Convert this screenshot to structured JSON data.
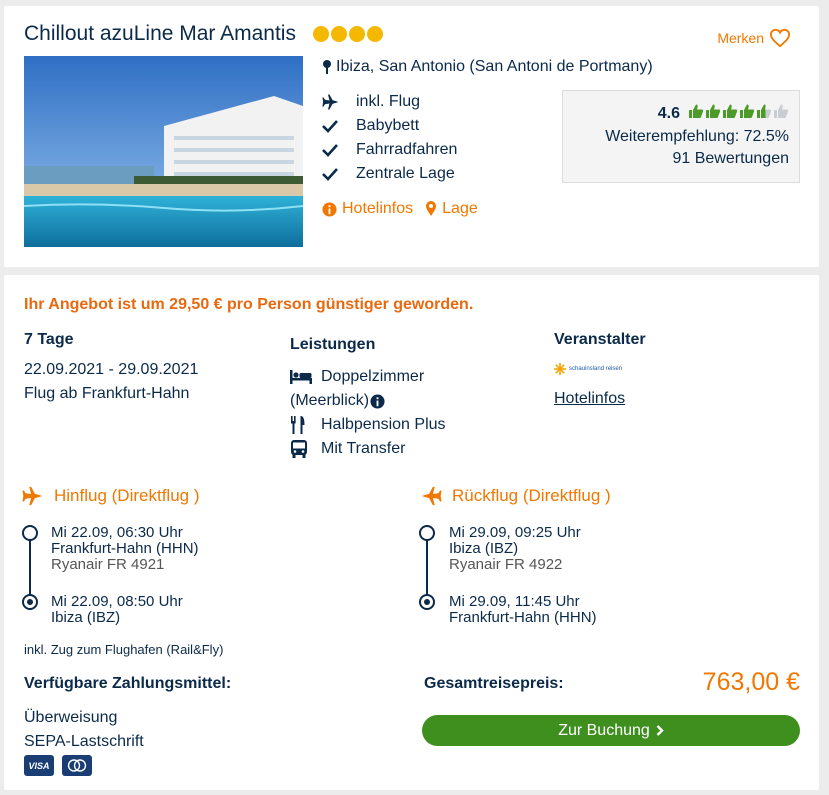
{
  "hotel": {
    "name": "Chillout azuLine Mar Amantis",
    "stars": 4,
    "merken_label": "Merken",
    "location": "Ibiza, San Antonio (San Antoni de Portmany)",
    "features": [
      "inkl. Flug",
      "Babybett",
      "Fahrradfahren",
      "Zentrale Lage"
    ],
    "links": {
      "hotelinfos": "Hotelinfos",
      "lage": "Lage"
    },
    "rating": {
      "score": "4.6",
      "thumbs_total": 6,
      "thumbs_value": 4.6,
      "recommendation": "Weiterempfehlung: 72.5%",
      "reviews": "91 Bewertungen"
    }
  },
  "offer": {
    "notice": "Ihr Angebot ist um 29,50 € pro Person günstiger geworden.",
    "duration": "7 Tage",
    "date_range": "22.09.2021 - 29.09.2021",
    "departure": "Flug ab Frankfurt-Hahn",
    "leistungen_heading": "Leistungen",
    "leistungen": {
      "room_line1": "Doppelzimmer",
      "room_line2": "(Meerblick)",
      "board": "Halbpension Plus",
      "transfer": "Mit Transfer"
    },
    "veranstalter_heading": "Veranstalter",
    "veranstalter_logo_text": "schauinsland reisen",
    "veranstalter_link": "Hotelinfos"
  },
  "flights": {
    "outbound": {
      "heading": "Hinflug (Direktflug )",
      "dep_time": "Mi 22.09, 06:30 Uhr",
      "dep_airport": "Frankfurt-Hahn (HHN)",
      "flight_no": "Ryanair FR 4921",
      "arr_time": "Mi 22.09, 08:50 Uhr",
      "arr_airport": "Ibiza (IBZ)"
    },
    "return": {
      "heading": "Rückflug (Direktflug )",
      "dep_time": "Mi 29.09, 09:25 Uhr",
      "dep_airport": "Ibiza (IBZ)",
      "flight_no": "Ryanair FR 4922",
      "arr_time": "Mi 29.09, 11:45 Uhr",
      "arr_airport": "Frankfurt-Hahn (HHN)"
    },
    "rail_fly": "inkl. Zug zum Flughafen (Rail&Fly)"
  },
  "payment": {
    "heading": "Verfügbare Zahlungsmittel:",
    "methods": [
      "Überweisung",
      "SEPA-Lastschrift"
    ],
    "card_visa": "VISA"
  },
  "total": {
    "label": "Gesamtreisepreis:",
    "price": "763,00 €",
    "button": "Zur Buchung"
  },
  "colors": {
    "accent": "#f07800",
    "navy": "#0b2a4a",
    "button_green": "#3f8f1f",
    "thumb_green": "#4c9a2a"
  }
}
